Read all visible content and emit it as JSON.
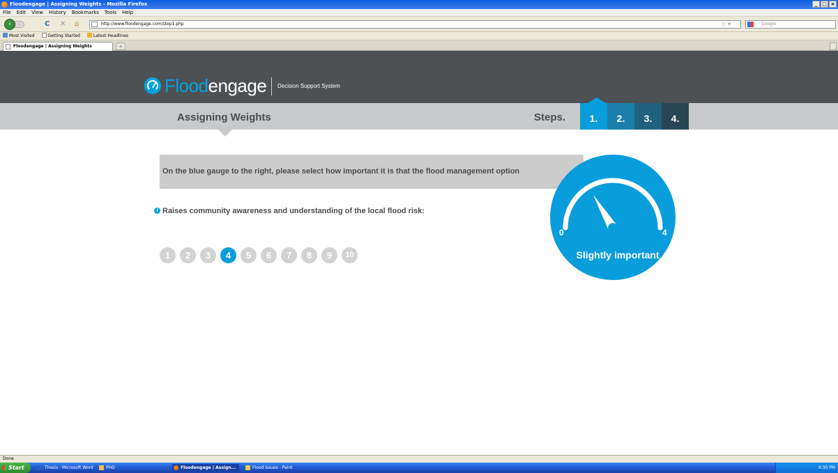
{
  "window": {
    "title": "Floodengage | Assigning Weights - Mozilla Firefox"
  },
  "menu": [
    "File",
    "Edit",
    "View",
    "History",
    "Bookmarks",
    "Tools",
    "Help"
  ],
  "address": {
    "url": "http://www.floodengage.com/step1.php"
  },
  "search": {
    "placeholder": "Google"
  },
  "bookmarks": [
    "Most Visited",
    "Getting Started",
    "Latest Headlines"
  ],
  "tab": {
    "title": "Floodengage | Assigning Weights",
    "new_tab": "+"
  },
  "site": {
    "logo_part1": "Flood",
    "logo_part2": "engage",
    "subtitle": "Decision Support System",
    "page_title": "Assigning Weights",
    "steps_label": "Steps.",
    "steps": [
      {
        "label": "1.",
        "color": "#0a9ddb"
      },
      {
        "label": "2.",
        "color": "#1c7fab"
      },
      {
        "label": "3.",
        "color": "#22617e"
      },
      {
        "label": "4.",
        "color": "#284653"
      }
    ],
    "active_step": 1
  },
  "question": {
    "prompt": "On the blue gauge to the right, please select how important it is that the flood management option",
    "option_icon": "info-icon",
    "option_text": "Raises community awareness and understanding of the local flood risk:"
  },
  "scale": {
    "options": [
      "1",
      "2",
      "3",
      "4",
      "5",
      "6",
      "7",
      "8",
      "9",
      "10"
    ],
    "selected": 4
  },
  "gauge": {
    "min_label": "0",
    "max_label": "4",
    "value_label": "Slightly important",
    "color": "#0a9ddb"
  },
  "status": {
    "text": "Done"
  },
  "taskbar": {
    "start": "Start",
    "items": [
      "Thesis - Microsoft Word",
      "PHD",
      "Floodengage | Assign...",
      "Flood issues - Paint"
    ],
    "clock": "9:30 PM"
  }
}
